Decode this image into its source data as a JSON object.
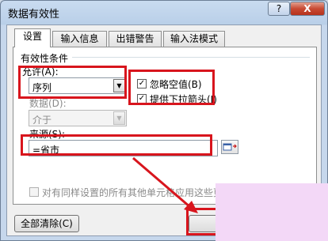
{
  "dialog": {
    "title": "数据有效性",
    "help_label": "?",
    "close_label": "X"
  },
  "tabs": [
    {
      "label": "设置",
      "active": true
    },
    {
      "label": "输入信息",
      "active": false
    },
    {
      "label": "出错警告",
      "active": false
    },
    {
      "label": "输入法模式",
      "active": false
    }
  ],
  "settings": {
    "group_label": "有效性条件",
    "allow_label": "允许(A):",
    "allow_value": "序列",
    "ignore_blank_label": "忽略空值(B)",
    "ignore_blank_checked": true,
    "dropdown_label": "提供下拉箭头(I)",
    "dropdown_checked": true,
    "data_label": "数据(D):",
    "data_value": "介于",
    "source_label": "来源(S):",
    "source_value": "=省市",
    "apply_all_label": "对有同样设置的所有其他单元格应用这些更",
    "apply_all_checked": false
  },
  "footer": {
    "clear_all_label": "全部清除(C)"
  },
  "colors": {
    "highlight": "#d8151d",
    "overlay": "#f3d8f7"
  }
}
